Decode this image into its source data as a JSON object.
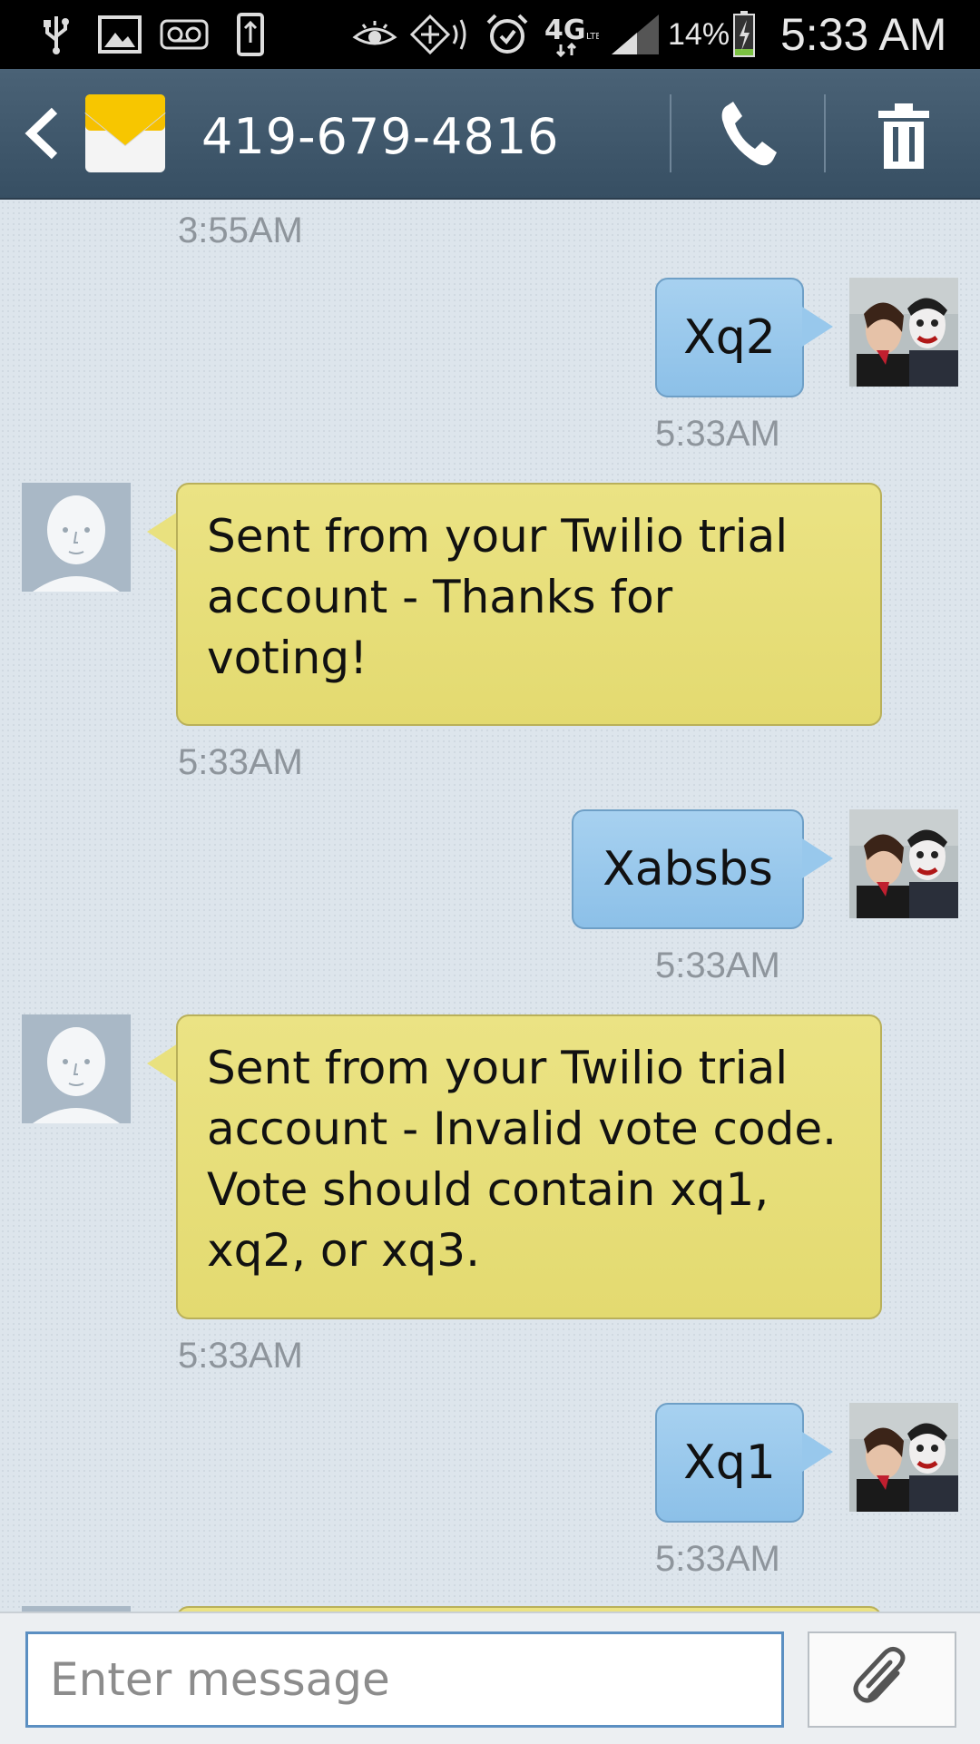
{
  "status_bar": {
    "battery": "14%",
    "time": "5:33 AM",
    "network": "4G",
    "icons": [
      "usb-icon",
      "gallery-icon",
      "voicemail-icon",
      "phone-update-icon",
      "eye-icon",
      "nfc-icon",
      "alarm-icon",
      "network-4g-icon",
      "signal-icon",
      "battery-charging-icon"
    ]
  },
  "header": {
    "title": "419-679-4816",
    "icons": [
      "back-icon",
      "message-app-icon",
      "call-icon",
      "trash-icon"
    ]
  },
  "messages": [
    {
      "type": "timestamp",
      "text": "3:55AM"
    },
    {
      "type": "outgoing",
      "text": "Xq2",
      "time": "5:33AM"
    },
    {
      "type": "incoming",
      "lines": [
        "Sent from your Twilio trial",
        "account - Thanks for",
        "voting!"
      ],
      "time": "5:33AM"
    },
    {
      "type": "outgoing",
      "text": "Xabsbs",
      "time": "5:33AM"
    },
    {
      "type": "incoming",
      "lines": [
        "Sent from your Twilio trial",
        "account - Invalid vote code.",
        "Vote should contain xq1,",
        "xq2, or xq3."
      ],
      "time": "5:33AM"
    },
    {
      "type": "outgoing",
      "text": "Xq1",
      "time": "5:33AM"
    }
  ],
  "composer": {
    "placeholder": "Enter message",
    "attach_icon": "paperclip-icon"
  },
  "colors": {
    "outgoing_bubble": "#9ccaee",
    "incoming_bubble": "#e7df78",
    "header_bg": "#405a6e",
    "conversation_bg": "#dde5ec"
  }
}
